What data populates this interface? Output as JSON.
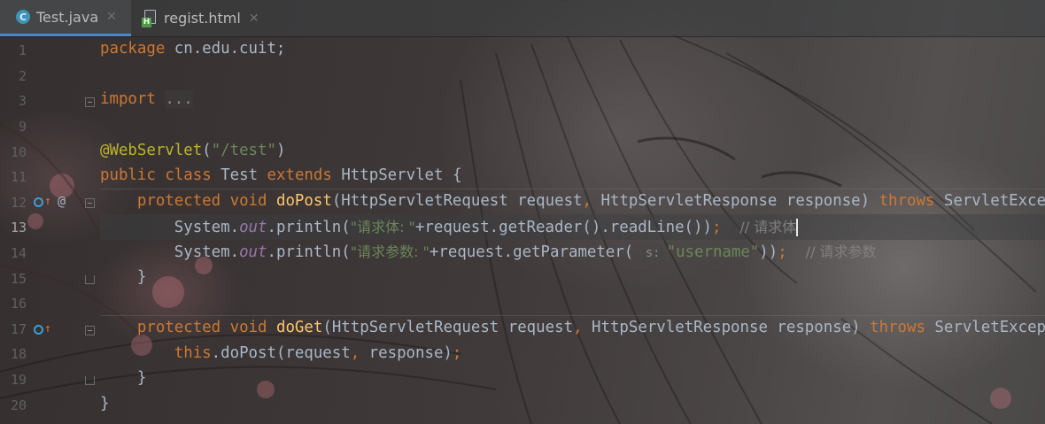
{
  "tabs": [
    {
      "label": "Test.java",
      "icon": "java-class-icon",
      "active": true
    },
    {
      "label": "regist.html",
      "icon": "html-file-icon",
      "active": false
    }
  ],
  "gutter": {
    "line_numbers": [
      "1",
      "2",
      "3",
      "9",
      "10",
      "11",
      "12",
      "13",
      "14",
      "15",
      "16",
      "17",
      "18",
      "19",
      "20"
    ],
    "at_marker": "@"
  },
  "code": {
    "l1_kw": "package",
    "l1_rest": " cn.edu.cuit;",
    "l3_kw": "import",
    "l3_fold": "...",
    "l10_ann": "@WebServlet",
    "l10_open": "(",
    "l10_str": "\"/test\"",
    "l10_close": ")",
    "l11_kw1": "public",
    "l11_kw2": "class",
    "l11_name": "Test",
    "l11_kw3": "extends",
    "l11_rest": "HttpServlet {",
    "l12_kw1": "protected",
    "l12_kw2": "void",
    "l12_fn": "doPost",
    "l12_params1": "(HttpServletRequest request",
    "l12_comma": ",",
    "l12_params2": " HttpServletResponse response) ",
    "l12_throws": "throws",
    "l12_tail": " ServletException",
    "l13_sys": "System.",
    "l13_out": "out",
    "l13_print": ".println(",
    "l13_str": "\"请求体: \"",
    "l13_rest": "+request.getReader().readLine())",
    "l13_semi": ";",
    "l13_cmt": "// 请求体",
    "l14_sys": "System.",
    "l14_out": "out",
    "l14_print": ".println(",
    "l14_str": "\"请求参数: \"",
    "l14_rest": "+request.getParameter( ",
    "l14_hint": "s:",
    "l14_str2": "\"username\"",
    "l14_close": "))",
    "l14_semi": ";",
    "l14_cmt": "// 请求参数",
    "l15_brace": "}",
    "l17_kw1": "protected",
    "l17_kw2": "void",
    "l17_fn": "doGet",
    "l17_params1": "(HttpServletRequest request",
    "l17_comma": ",",
    "l17_params2": " HttpServletResponse response) ",
    "l17_throws": "throws",
    "l17_tail": " ServletException",
    "l18_this": "this",
    "l18_rest": ".doPost(request",
    "l18_comma": ",",
    "l18_rest2": " response)",
    "l18_semi": ";",
    "l19_brace": "}",
    "l20_brace": "}"
  },
  "colors": {
    "keyword": "#cc7832",
    "annotation": "#bbb529",
    "string": "#6a8759",
    "method": "#ffc66d",
    "static_field": "#9876aa",
    "comment": "#808080",
    "text": "#a9b7c6",
    "tab_underline": "#4a88c7"
  }
}
